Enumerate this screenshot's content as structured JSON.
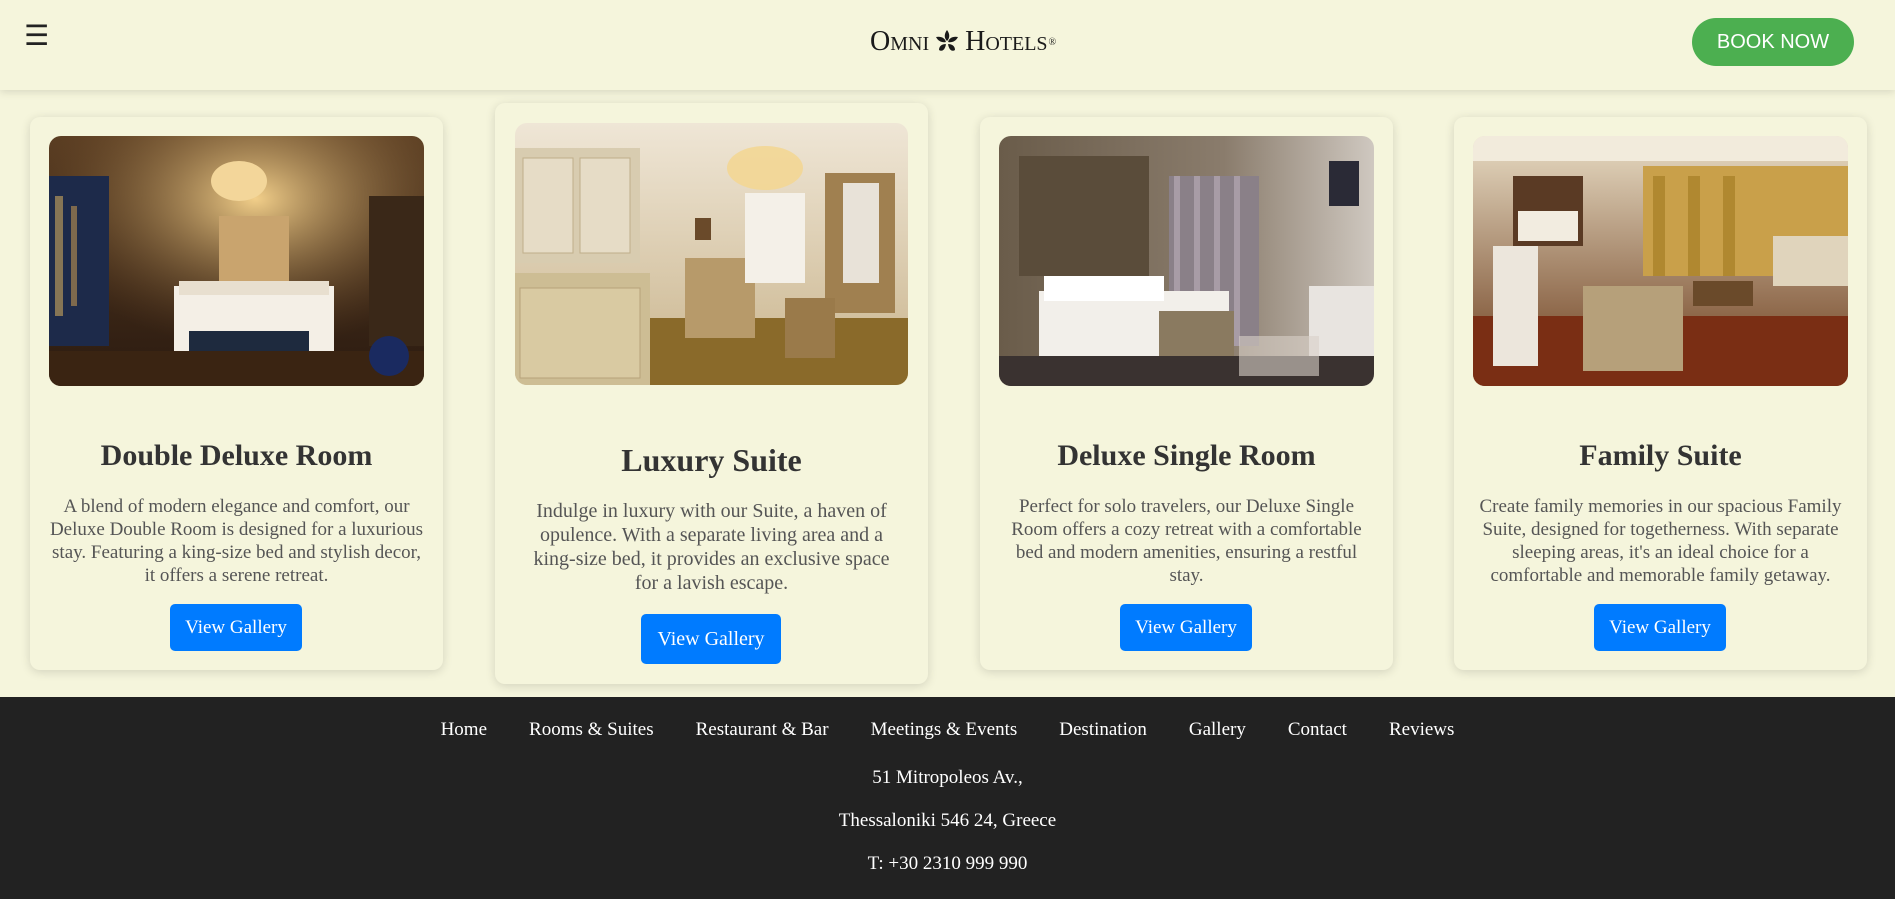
{
  "header": {
    "menu_icon": "☰",
    "logo": {
      "left": "Omni",
      "right": "Hotels",
      "mark": "fleur-icon"
    },
    "book_label": "BOOK NOW"
  },
  "colors": {
    "page_bg": "#f5f5dc",
    "book_button": "#4caf50",
    "gallery_button": "#007bff",
    "footer_bg": "#222222"
  },
  "rooms": [
    {
      "title": "Double Deluxe Room",
      "description": "A blend of modern elegance and comfort, our Deluxe Double Room is designed for a luxurious stay. Featuring a king-size bed and stylish decor, it offers a serene retreat.",
      "button_label": "View Gallery"
    },
    {
      "title": "Luxury Suite",
      "description": "Indulge in luxury with our Suite, a haven of opulence. With a separate living area and a king-size bed, it provides an exclusive space for a lavish escape.",
      "button_label": "View Gallery"
    },
    {
      "title": "Deluxe Single Room",
      "description": "Perfect for solo travelers, our Deluxe Single Room offers a cozy retreat with a comfortable bed and modern amenities, ensuring a restful stay.",
      "button_label": "View Gallery"
    },
    {
      "title": "Family Suite",
      "description": "Create family memories in our spacious Family Suite, designed for togetherness. With separate sleeping areas, it's an ideal choice for a comfortable and memorable family getaway.",
      "button_label": "View Gallery"
    }
  ],
  "footer": {
    "nav": [
      "Home",
      "Rooms & Suites",
      "Restaurant & Bar",
      "Meetings & Events",
      "Destination",
      "Gallery",
      "Contact",
      "Reviews"
    ],
    "address_line1": "51 Mitropoleos Av.,",
    "address_line2": "Thessaloniki 546 24, Greece",
    "phone": "T: +30 2310 999 990"
  }
}
